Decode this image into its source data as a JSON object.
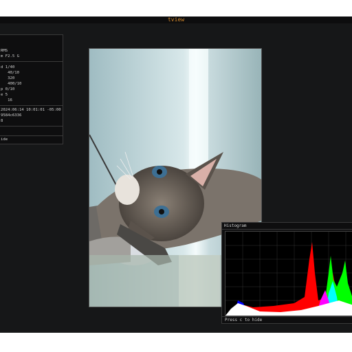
{
  "window": {
    "title": "tview"
  },
  "exif": {
    "lines": [
      "RMS",
      "m F2.5 G",
      "d 1/40",
      "   40/10",
      "   320",
      "   400/10",
      "p 0/10",
      "e 5",
      "   16",
      "2024:06:14 10:01:01 -05:00",
      "9584c6336",
      "8"
    ],
    "hint": "ide"
  },
  "histogram": {
    "title": "Histogram",
    "hint": "Press c to hide",
    "colors": {
      "red": "#ff0000",
      "green": "#00ff00",
      "blue": "#0000ff",
      "cyan": "#00ffff",
      "magenta": "#ff00ff",
      "white": "#ffffff"
    }
  },
  "photo": {
    "description_icon": "cat-photo"
  }
}
